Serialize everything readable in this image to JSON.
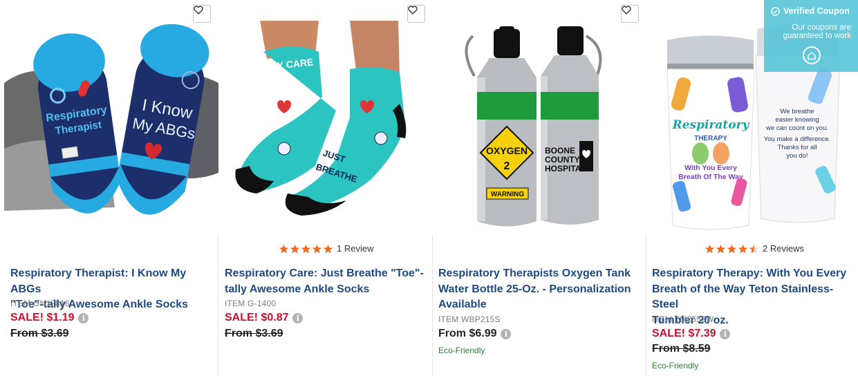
{
  "products": [
    {
      "title_line1": "Respiratory Therapist: I Know My ABGs",
      "title_line2": "\"Toe\"-tally Awesome Ankle Socks",
      "title_line3": "",
      "item": "ITEM GN12816",
      "sale": "SALE! $1.19",
      "from": "From $3.69",
      "reviews": "",
      "rating": 0,
      "eco": ""
    },
    {
      "title_line1": "Respiratory Care: Just Breathe \"Toe\"-",
      "title_line2": "tally Awesome Ankle Socks",
      "title_line3": "",
      "item": "ITEM G-1400",
      "sale": "SALE! $0.87",
      "from": "From $3.69",
      "reviews": "1 Review",
      "rating": 5,
      "eco": ""
    },
    {
      "title_line1": "Respiratory Therapists Oxygen Tank",
      "title_line2": "Water Bottle 25-Oz. - Personalization",
      "title_line3": "Available",
      "item": "ITEM WBP215S",
      "sale": "",
      "from": "From $6.99",
      "reviews": "",
      "rating": 0,
      "eco": "Eco-Friendly"
    },
    {
      "title_line1": "Respiratory Therapy: With You Every",
      "title_line2": "Breath of the Way Teton Stainless-Steel",
      "title_line3": "Tumbler 20 oz.",
      "item": "ITEM TM2552W",
      "sale": "SALE! $7.39",
      "from": "From $8.59",
      "reviews": "2 Reviews",
      "rating": 4.5,
      "eco": "Eco-Friendly"
    }
  ],
  "images": {
    "socks1": {
      "line1": "Respiratory",
      "line2": "Therapist",
      "line3": "I Know",
      "line4": "My ABGs"
    },
    "socks2": {
      "cuff": "ORY CARE",
      "text1": "JUST",
      "text2": "BREATHE"
    },
    "bottle": {
      "oxy1": "OXYGEN",
      "oxy2": "2",
      "warn": "WARNING",
      "hosp1": "BOONE",
      "hosp2": "COUNTY",
      "hosp3": "HOSPITAL"
    },
    "tumbler": {
      "word1": "Respiratory",
      "word2": "THERAPY",
      "word3": "With You Every",
      "word4": "Breath Of The Way",
      "back1": "We breathe",
      "back2": "easier knowing",
      "back3": "we can count on you.",
      "back4": "You make a difference.",
      "back5": "Thanks for all",
      "back6": "you do!"
    }
  },
  "coupon": {
    "title": "Verified Coupon",
    "line1": "Our coupons are",
    "line2": "guaranteed to work"
  },
  "colors": {
    "title_blue": "#1d4a80",
    "sale_red": "#c8102e",
    "star_orange": "#f26b1d",
    "eco_green": "#2f7d32",
    "coupon_teal": "#52c4d6"
  },
  "icons": [
    "heart-icon",
    "star-icon",
    "info-icon",
    "check-circle-icon",
    "house-badge-icon"
  ]
}
